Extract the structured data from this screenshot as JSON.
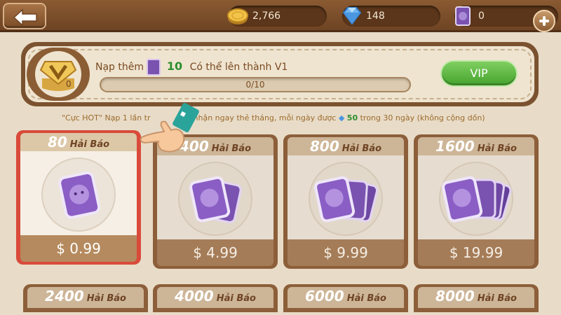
{
  "colors": {
    "accent_gold": "#d4a84a",
    "vip_green": "#45a32e",
    "selected_border": "#d94a3a",
    "card_purple": "#7a52b0"
  },
  "topbar": {
    "back_icon": "back-arrow-icon",
    "gold": "2,766",
    "diamond": "148",
    "cards": "0",
    "plus_icon": "plus-icon"
  },
  "vip": {
    "text_prefix": "Nạp thêm",
    "amount": "10",
    "text_suffix": "Có thể lên thành V1",
    "progress_label": "0/10",
    "progress_value": 0,
    "button_label": "VIP"
  },
  "promo": {
    "text_a": "\"Cực HOT\" Nạp 1 lần tr",
    "text_b": "nhận ngay thẻ tháng, mỗi ngày được",
    "bonus": "50",
    "text_c": "trong 30 ngày (không cộng dồn)"
  },
  "packages": [
    {
      "amount": "80",
      "unit": "Hải Báo",
      "price": "$ 0.99",
      "selected": true
    },
    {
      "amount": "400",
      "unit": "Hải Báo",
      "price": "$ 4.99",
      "selected": false
    },
    {
      "amount": "800",
      "unit": "Hải Báo",
      "price": "$ 9.99",
      "selected": false
    },
    {
      "amount": "1600",
      "unit": "Hải Báo",
      "price": "$ 19.99",
      "selected": false
    }
  ],
  "packages_row2": [
    {
      "amount": "2400",
      "unit": "Hải Báo"
    },
    {
      "amount": "4000",
      "unit": "Hải Báo"
    },
    {
      "amount": "6000",
      "unit": "Hải Báo"
    },
    {
      "amount": "8000",
      "unit": "Hải Báo"
    }
  ]
}
